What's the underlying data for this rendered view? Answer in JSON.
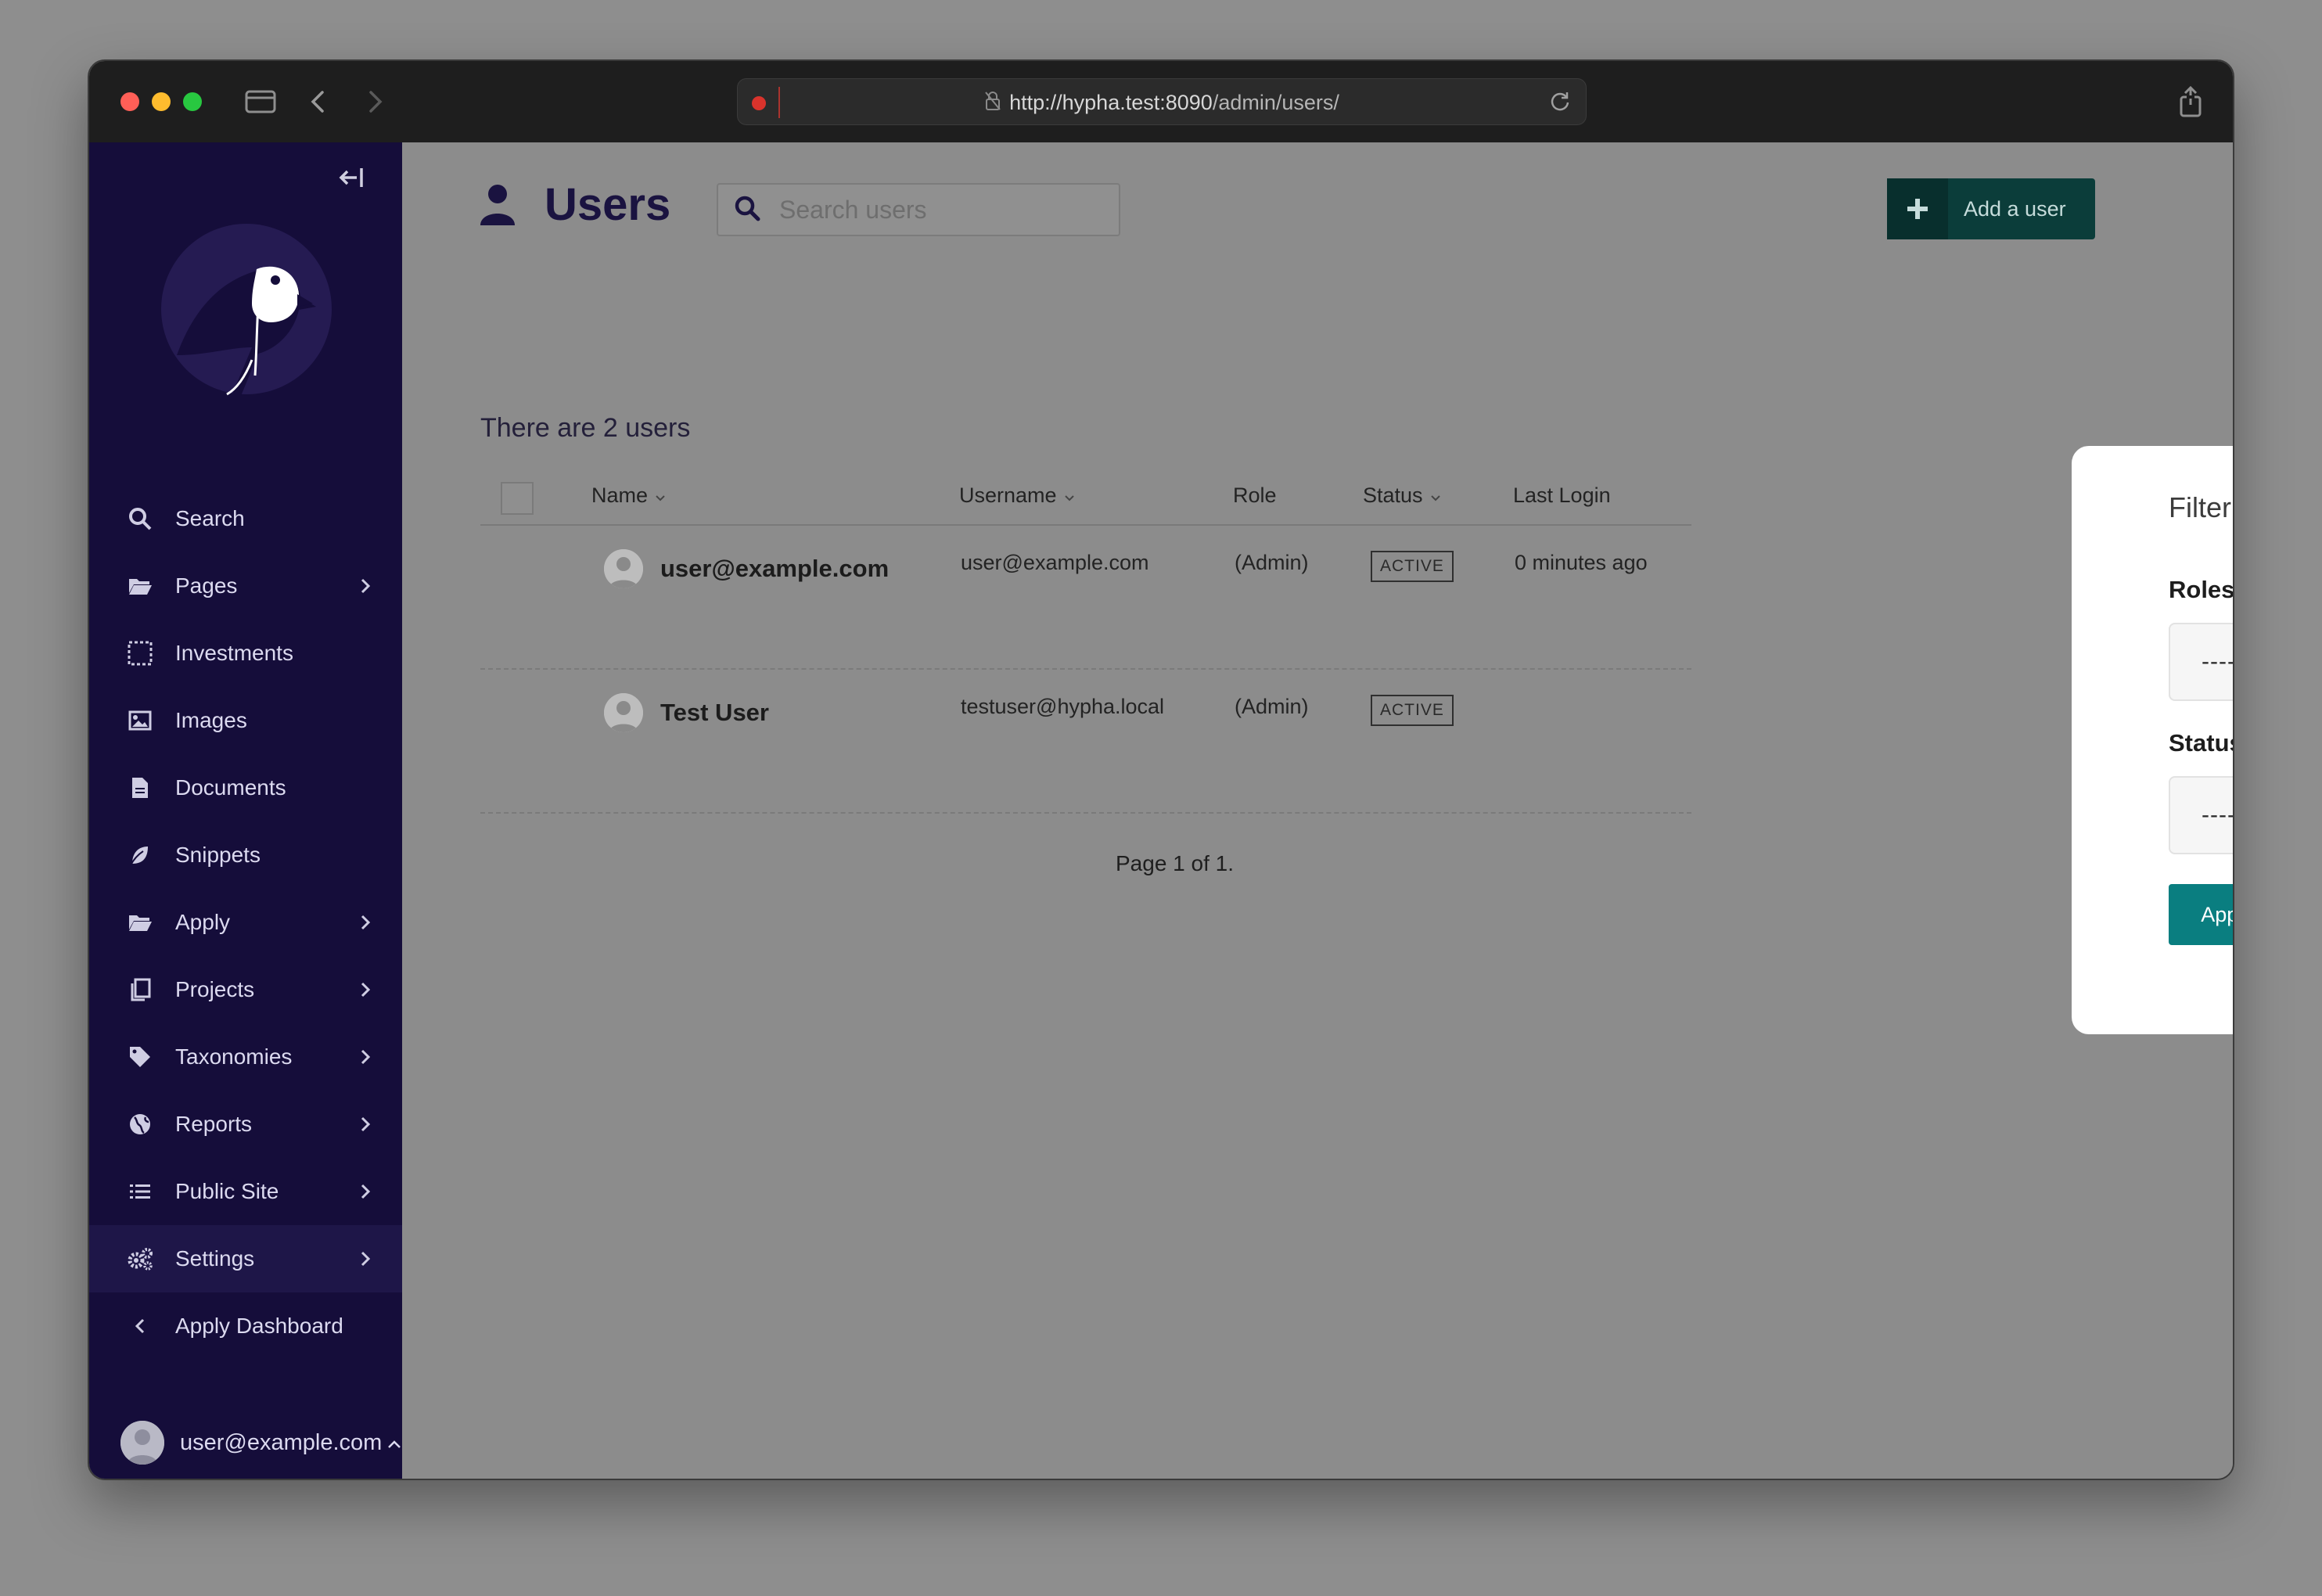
{
  "browser": {
    "url_host": "http://hypha.test:8090",
    "url_path": "/admin/users/"
  },
  "sidebar": {
    "items": [
      {
        "label": "Search",
        "icon": "search-icon"
      },
      {
        "label": "Pages",
        "icon": "folder-open-icon"
      },
      {
        "label": "Investments",
        "icon": "dashed-box-icon"
      },
      {
        "label": "Images",
        "icon": "image-icon"
      },
      {
        "label": "Documents",
        "icon": "document-icon"
      },
      {
        "label": "Snippets",
        "icon": "leaf-icon"
      },
      {
        "label": "Apply",
        "icon": "folder-open-icon"
      },
      {
        "label": "Projects",
        "icon": "copy-icon"
      },
      {
        "label": "Taxonomies",
        "icon": "tag-icon"
      },
      {
        "label": "Reports",
        "icon": "globe-icon"
      },
      {
        "label": "Public Site",
        "icon": "list-icon"
      },
      {
        "label": "Settings",
        "icon": "cogs-icon"
      },
      {
        "label": "Apply Dashboard",
        "icon": "chevron-left-icon"
      }
    ],
    "account": "user@example.com"
  },
  "header": {
    "title": "Users",
    "search_placeholder": "Search users",
    "add_label": "Add a user"
  },
  "listing": {
    "count_text": "There are 2 users",
    "columns": [
      "Name",
      "Username",
      "Role",
      "Status",
      "Last Login"
    ],
    "rows": [
      {
        "name": "user@example.com",
        "username": "user@example.com",
        "role": "(Admin)",
        "status": "ACTIVE",
        "last_login": "0 minutes ago"
      },
      {
        "name": "Test User",
        "username": "testuser@hypha.local",
        "role": "(Admin)",
        "status": "ACTIVE",
        "last_login": ""
      }
    ],
    "pagination": "Page 1 of 1."
  },
  "filter": {
    "title": "Filter",
    "roles_label": "Roles:",
    "roles_value": "---------",
    "status_label": "Status:",
    "status_value": "---------",
    "apply_label": "Apply filters"
  },
  "colors": {
    "sidebar_bg": "#150d3a",
    "accent_teal": "#0a7e80",
    "add_button": "#0b3d3a"
  }
}
